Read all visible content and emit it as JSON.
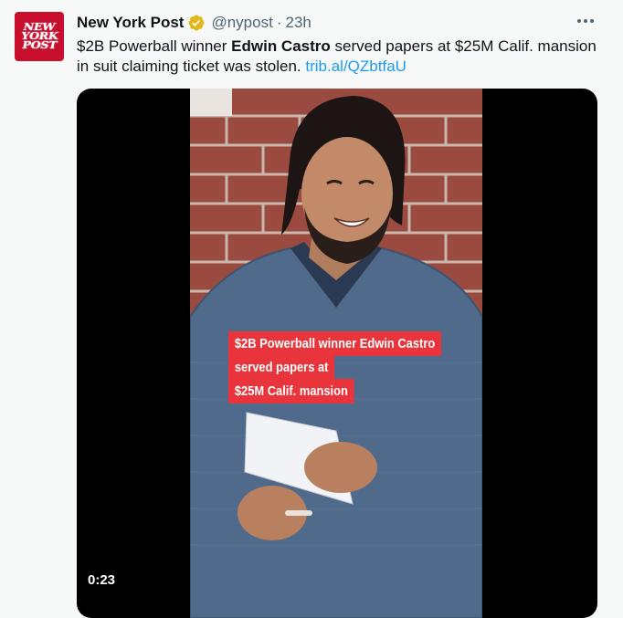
{
  "author": {
    "name": "New York Post",
    "handle": "@nypost",
    "separator": "·",
    "time": "23h",
    "avatar_lines": [
      "NEW",
      "YORK",
      "POST"
    ]
  },
  "tweet": {
    "text_1": "$2B Powerball winner ",
    "text_bold": "Edwin Castro",
    "text_2": " served papers at $25M Calif. mansion in suit claiming ticket was stolen. ",
    "link": "trib.al/QZbtfaU"
  },
  "video": {
    "overlay_lines": [
      "$2B Powerball winner Edwin Castro",
      "served papers at",
      "$25M Calif. mansion"
    ],
    "duration": "0:23"
  },
  "icons": [
    "verified-badge-icon",
    "more-options-icon"
  ],
  "colors": {
    "accent": "#1d9bf0",
    "brand": "#c8102e",
    "overlay": "#e8343a"
  }
}
